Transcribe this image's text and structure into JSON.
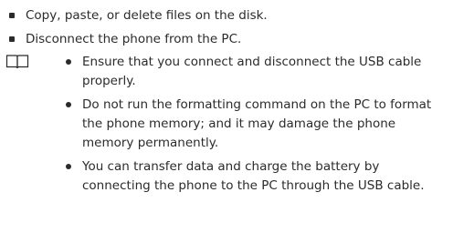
{
  "bullets": [
    "Copy, paste, or delete files on the disk.",
    "Disconnect the phone from the PC."
  ],
  "note": {
    "icon": "book-icon",
    "items": [
      "Ensure that you connect and disconnect the USB cable properly.",
      "Do not run the formatting command on the PC to format the phone memory; and it may damage the phone memory permanently.",
      "You can transfer data and charge the battery by connecting the phone to the PC through the USB cable."
    ]
  }
}
